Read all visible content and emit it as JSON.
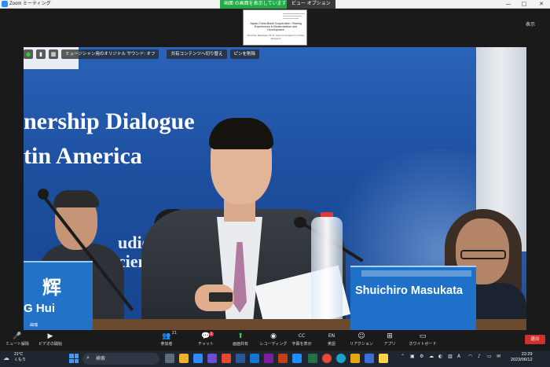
{
  "window": {
    "app_title": "Zoom ミーティング",
    "share_banner": "画面 の画面を表示しています",
    "view_options": "ビュー オプション",
    "view_toggle": "表示",
    "controls": [
      "—",
      "□",
      "✕"
    ]
  },
  "slide_thumbnail": {
    "title": "Japan-China-Brazil Cooperation: Sharing Experiences in Modernization and Development",
    "presenter": "Shuichiro Masukata, Ph.D. Tokyo Foundation for Policy Research"
  },
  "video_overlay": {
    "original_sound": "ミュージシャン用のオリジナル サウンド: オフ",
    "switch_share": "共有コンテンツへ切り替え",
    "unpin": "ピンを削除"
  },
  "video_scene": {
    "banner_line1": "nership Dialogue",
    "banner_line2": "tin America",
    "banner_line3": "udies",
    "banner_line4": "l Scien",
    "nameplate_left_cn": "辉",
    "nameplate_left_en": "G Hui",
    "nameplate_right_en": "Shuichiro Masukata",
    "participant_label": "曲瑞"
  },
  "meeting_controls": [
    {
      "label": "ミュート解除",
      "icon": "🎤"
    },
    {
      "label": "ビデオの開始",
      "icon": "▶"
    },
    {
      "label": "参加者",
      "icon": "👥",
      "count": "21"
    },
    {
      "label": "チャット",
      "icon": "💬",
      "badge": "1"
    },
    {
      "label": "画面共有",
      "icon": "⬆"
    },
    {
      "label": "レコーディング",
      "icon": "◉"
    },
    {
      "label": "字幕を表示",
      "icon": "CC"
    },
    {
      "label": "英語",
      "icon": "EN"
    },
    {
      "label": "リアクション",
      "icon": "☺"
    },
    {
      "label": "アプリ",
      "icon": "⊞"
    },
    {
      "label": "ホワイトボード",
      "icon": "▭"
    }
  ],
  "end_button": "退出",
  "taskbar": {
    "weather_temp": "21°C",
    "weather_desc": "くもり",
    "search_label": "検索",
    "time": "22:29",
    "date": "2023/06/12"
  }
}
